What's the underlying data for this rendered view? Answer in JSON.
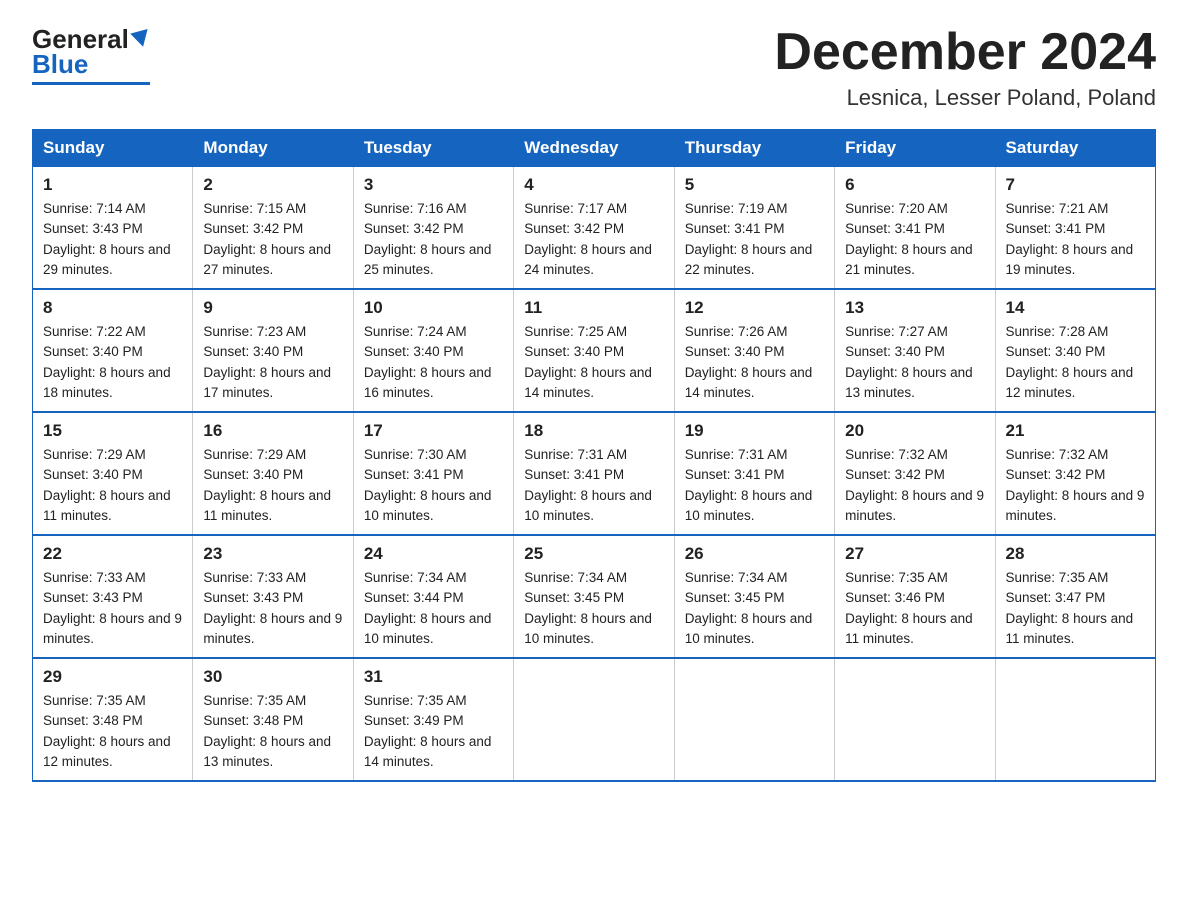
{
  "logo": {
    "general": "General",
    "blue": "Blue"
  },
  "title": "December 2024",
  "location": "Lesnica, Lesser Poland, Poland",
  "days_of_week": [
    "Sunday",
    "Monday",
    "Tuesday",
    "Wednesday",
    "Thursday",
    "Friday",
    "Saturday"
  ],
  "weeks": [
    [
      {
        "day": "1",
        "sunrise": "7:14 AM",
        "sunset": "3:43 PM",
        "daylight": "8 hours and 29 minutes."
      },
      {
        "day": "2",
        "sunrise": "7:15 AM",
        "sunset": "3:42 PM",
        "daylight": "8 hours and 27 minutes."
      },
      {
        "day": "3",
        "sunrise": "7:16 AM",
        "sunset": "3:42 PM",
        "daylight": "8 hours and 25 minutes."
      },
      {
        "day": "4",
        "sunrise": "7:17 AM",
        "sunset": "3:42 PM",
        "daylight": "8 hours and 24 minutes."
      },
      {
        "day": "5",
        "sunrise": "7:19 AM",
        "sunset": "3:41 PM",
        "daylight": "8 hours and 22 minutes."
      },
      {
        "day": "6",
        "sunrise": "7:20 AM",
        "sunset": "3:41 PM",
        "daylight": "8 hours and 21 minutes."
      },
      {
        "day": "7",
        "sunrise": "7:21 AM",
        "sunset": "3:41 PM",
        "daylight": "8 hours and 19 minutes."
      }
    ],
    [
      {
        "day": "8",
        "sunrise": "7:22 AM",
        "sunset": "3:40 PM",
        "daylight": "8 hours and 18 minutes."
      },
      {
        "day": "9",
        "sunrise": "7:23 AM",
        "sunset": "3:40 PM",
        "daylight": "8 hours and 17 minutes."
      },
      {
        "day": "10",
        "sunrise": "7:24 AM",
        "sunset": "3:40 PM",
        "daylight": "8 hours and 16 minutes."
      },
      {
        "day": "11",
        "sunrise": "7:25 AM",
        "sunset": "3:40 PM",
        "daylight": "8 hours and 14 minutes."
      },
      {
        "day": "12",
        "sunrise": "7:26 AM",
        "sunset": "3:40 PM",
        "daylight": "8 hours and 14 minutes."
      },
      {
        "day": "13",
        "sunrise": "7:27 AM",
        "sunset": "3:40 PM",
        "daylight": "8 hours and 13 minutes."
      },
      {
        "day": "14",
        "sunrise": "7:28 AM",
        "sunset": "3:40 PM",
        "daylight": "8 hours and 12 minutes."
      }
    ],
    [
      {
        "day": "15",
        "sunrise": "7:29 AM",
        "sunset": "3:40 PM",
        "daylight": "8 hours and 11 minutes."
      },
      {
        "day": "16",
        "sunrise": "7:29 AM",
        "sunset": "3:40 PM",
        "daylight": "8 hours and 11 minutes."
      },
      {
        "day": "17",
        "sunrise": "7:30 AM",
        "sunset": "3:41 PM",
        "daylight": "8 hours and 10 minutes."
      },
      {
        "day": "18",
        "sunrise": "7:31 AM",
        "sunset": "3:41 PM",
        "daylight": "8 hours and 10 minutes."
      },
      {
        "day": "19",
        "sunrise": "7:31 AM",
        "sunset": "3:41 PM",
        "daylight": "8 hours and 10 minutes."
      },
      {
        "day": "20",
        "sunrise": "7:32 AM",
        "sunset": "3:42 PM",
        "daylight": "8 hours and 9 minutes."
      },
      {
        "day": "21",
        "sunrise": "7:32 AM",
        "sunset": "3:42 PM",
        "daylight": "8 hours and 9 minutes."
      }
    ],
    [
      {
        "day": "22",
        "sunrise": "7:33 AM",
        "sunset": "3:43 PM",
        "daylight": "8 hours and 9 minutes."
      },
      {
        "day": "23",
        "sunrise": "7:33 AM",
        "sunset": "3:43 PM",
        "daylight": "8 hours and 9 minutes."
      },
      {
        "day": "24",
        "sunrise": "7:34 AM",
        "sunset": "3:44 PM",
        "daylight": "8 hours and 10 minutes."
      },
      {
        "day": "25",
        "sunrise": "7:34 AM",
        "sunset": "3:45 PM",
        "daylight": "8 hours and 10 minutes."
      },
      {
        "day": "26",
        "sunrise": "7:34 AM",
        "sunset": "3:45 PM",
        "daylight": "8 hours and 10 minutes."
      },
      {
        "day": "27",
        "sunrise": "7:35 AM",
        "sunset": "3:46 PM",
        "daylight": "8 hours and 11 minutes."
      },
      {
        "day": "28",
        "sunrise": "7:35 AM",
        "sunset": "3:47 PM",
        "daylight": "8 hours and 11 minutes."
      }
    ],
    [
      {
        "day": "29",
        "sunrise": "7:35 AM",
        "sunset": "3:48 PM",
        "daylight": "8 hours and 12 minutes."
      },
      {
        "day": "30",
        "sunrise": "7:35 AM",
        "sunset": "3:48 PM",
        "daylight": "8 hours and 13 minutes."
      },
      {
        "day": "31",
        "sunrise": "7:35 AM",
        "sunset": "3:49 PM",
        "daylight": "8 hours and 14 minutes."
      },
      null,
      null,
      null,
      null
    ]
  ]
}
